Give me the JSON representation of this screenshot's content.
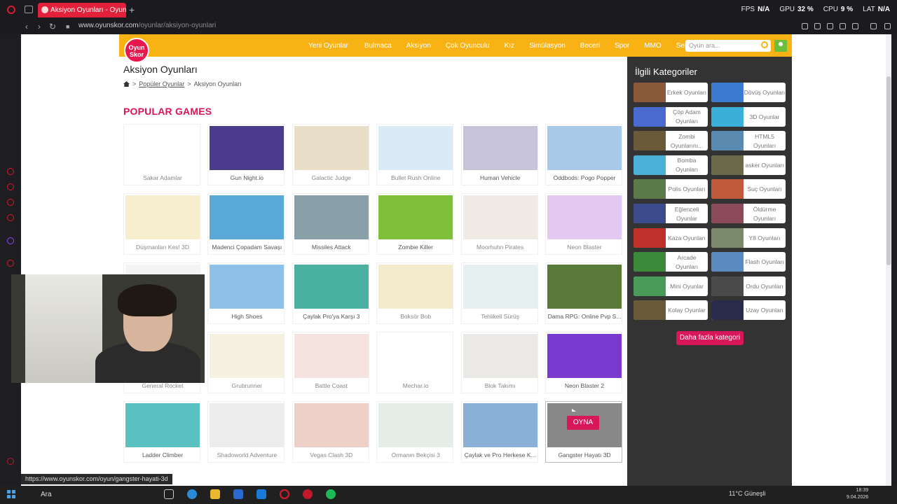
{
  "browser": {
    "tab_title": "Aksiyon Oyunları - Oyunsk",
    "url_host": "www.oyunskor.com",
    "url_path": "/oyunlar/aksiyon-oyunlari",
    "stats": [
      {
        "label": "FPS",
        "value": "N/A"
      },
      {
        "label": "GPU",
        "value": "32 %"
      },
      {
        "label": "CPU",
        "value": "9 %"
      },
      {
        "label": "LAT",
        "value": "N/A"
      }
    ],
    "status_url": "https://www.oyunskor.com/oyun/gangster-hayati-3d"
  },
  "site": {
    "logo_text": "Oyun Skor",
    "menu": [
      "Yeni Oyunlar",
      "Bulmaca",
      "Aksiyon",
      "Çok Oyunculu",
      "Kız",
      "Simülasyon",
      "Beceri",
      "Spor",
      "MMO",
      "Senin için"
    ],
    "search_placeholder": "Oyun ara...",
    "page_title": "Aksiyon Oyunları",
    "breadcrumb": [
      "Popüler Oyunlar",
      "Aksiyon Oyunları"
    ],
    "section_title": "POPULAR GAMES",
    "play_label": "OYNA"
  },
  "games": [
    {
      "name": "Sakar Adamlar",
      "color": "#ffffff",
      "dim": true
    },
    {
      "name": "Gun Night.io",
      "color": "#4a3b8c",
      "dim": false
    },
    {
      "name": "Galactic Judge",
      "color": "#b08a3a",
      "dim": true
    },
    {
      "name": "Bullet Rush Online",
      "color": "#7fb7e0",
      "dim": true
    },
    {
      "name": "Human Vehicle",
      "color": "#c7c3d9",
      "dim": false
    },
    {
      "name": "Oddbods: Pogo Popper",
      "color": "#a9c9e8",
      "dim": false
    },
    {
      "name": "Düşmanları Kes! 3D",
      "color": "#e0c14a",
      "dim": true
    },
    {
      "name": "Madenci Çopadam Savaşı",
      "color": "#5aa8d8",
      "dim": false
    },
    {
      "name": "Missiles Attack",
      "color": "#8aa0a8",
      "dim": false
    },
    {
      "name": "Zombie Killer",
      "color": "#7fbf3a",
      "dim": false
    },
    {
      "name": "Moorhuhn Pirates",
      "color": "#c8b8a0",
      "dim": true
    },
    {
      "name": "Neon Blaster",
      "color": "#9b3bd0",
      "dim": true
    },
    {
      "name": "General Rocket",
      "color": "#d8d8d8",
      "dim": true
    },
    {
      "name": "High Shoes",
      "color": "#8fc1e8",
      "dim": false
    },
    {
      "name": "Çaylak Pro'ya Karşı 3",
      "color": "#4ab0a0",
      "dim": false
    },
    {
      "name": "Boksör Bob",
      "color": "#d7b84a",
      "dim": true
    },
    {
      "name": "Tehlikeli Sürüş",
      "color": "#a8c8c8",
      "dim": true
    },
    {
      "name": "Dama RPG: Online Pvp S...",
      "color": "#5a7a3a",
      "dim": false
    },
    {
      "name": "General Rocket",
      "color": "#d8c890",
      "dim": true
    },
    {
      "name": "Grubrunner",
      "color": "#e0c890",
      "dim": true
    },
    {
      "name": "Battle Coast",
      "color": "#d89a8a",
      "dim": true
    },
    {
      "name": "Mechar.io",
      "color": "#ffffff",
      "dim": true
    },
    {
      "name": "Blok Takımı",
      "color": "#b8b0a0",
      "dim": true
    },
    {
      "name": "Neon Blaster 2",
      "color": "#7a3ad0",
      "dim": false
    },
    {
      "name": "Ladder Climber",
      "color": "#5ac0c0",
      "dim": false
    },
    {
      "name": "Shadoworld Adventure",
      "color": "#c0c0c0",
      "dim": true
    },
    {
      "name": "Vegas Clash 3D",
      "color": "#c05a3a",
      "dim": true
    },
    {
      "name": "Ormanın Bekçisi 3",
      "color": "#a0c0b0",
      "dim": true
    },
    {
      "name": "Çaylak ve Pro Herkese K...",
      "color": "#8ab0d8",
      "dim": false
    },
    {
      "name": "Gangster Hayatı 3D",
      "color": "#888888",
      "dim": false,
      "hover": true
    }
  ],
  "related": {
    "title": "İlgili Kategoriler",
    "categories": [
      {
        "label": "Erkek Oyunları",
        "color": "#8a5a3a"
      },
      {
        "label": "Dövüş Oyunları",
        "color": "#3a7ad0"
      },
      {
        "label": "Çöp Adam Oyunları",
        "color": "#4a6ad0"
      },
      {
        "label": "3D Oyunlar",
        "color": "#3ab0d8"
      },
      {
        "label": "Zombi Oyunlarını...",
        "color": "#6a5a3a"
      },
      {
        "label": "HTML5 Oyunları",
        "color": "#5a8ab0"
      },
      {
        "label": "Bomba Oyunları",
        "color": "#4ab0d8"
      },
      {
        "label": "asker Oyunları",
        "color": "#6a6a4a"
      },
      {
        "label": "Polis Oyunları",
        "color": "#5a7a4a"
      },
      {
        "label": "Suç Oyunları",
        "color": "#c05a3a"
      },
      {
        "label": "Eğlenceli Oyunlar",
        "color": "#3a4a8a"
      },
      {
        "label": "Öldürme Oyunları",
        "color": "#8a4a5a"
      },
      {
        "label": "Kaza Oyunları",
        "color": "#c0302a"
      },
      {
        "label": "Y8 Oyunları",
        "color": "#7a8a6a"
      },
      {
        "label": "Arcade Oyunları",
        "color": "#3a8a3a"
      },
      {
        "label": "Flash Oyunları",
        "color": "#5a8ac0"
      },
      {
        "label": "Mini Oyunlar",
        "color": "#4a9a5a"
      },
      {
        "label": "Ordu Oyunları",
        "color": "#4a4a4a"
      },
      {
        "label": "Kolay Oyunlar",
        "color": "#6a5a3a"
      },
      {
        "label": "Uzay Oyunları",
        "color": "#2a2a4a"
      }
    ],
    "more_label": "Daha fazla kategori"
  },
  "taskbar": {
    "search_label": "Ara",
    "weather": "11°C  Güneşli",
    "time": "18:39",
    "date": "9.04.2026"
  }
}
